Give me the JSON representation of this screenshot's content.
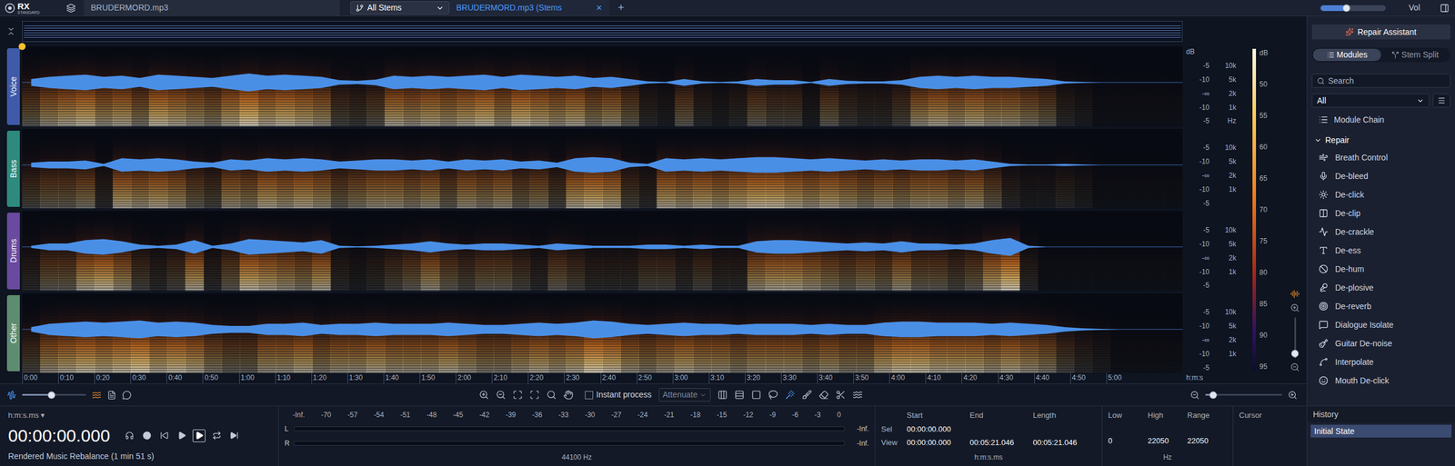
{
  "top_bar": {
    "logo": "RX",
    "edition": "STANDARD",
    "file_tab": "BRUDERMORD.mp3",
    "stem_select": "All Stems",
    "active_tab": "BRUDERMORD.mp3 (Stems",
    "close": "✕",
    "add": "+",
    "volume": {
      "label": "Vol",
      "level": 0.4
    }
  },
  "lanes": [
    {
      "name": "Voice",
      "color": "#3f5aa8",
      "waveform": [
        0.3,
        0.5,
        0.6,
        0.7,
        0.5,
        0.6,
        0.4,
        0.7,
        0.6,
        0.5,
        0.4,
        0.6,
        0.8,
        0.6,
        0.7,
        0.6,
        0.5,
        0.2,
        0.15,
        0.25,
        0.6,
        0.5,
        0.6,
        0.5,
        0.6,
        0.7,
        0.5,
        0.7,
        0.6,
        0.5,
        0.6,
        0.4,
        0.5,
        0.3,
        0.1,
        0.05,
        0.3,
        0.1,
        0.05,
        0.1,
        0.3,
        0.2,
        0.2,
        0.05,
        0.3,
        0.15,
        0.1,
        0.1,
        0.2,
        0.5,
        0.6,
        0.5,
        0.6,
        0.5,
        0.5,
        0.4,
        0.3,
        0.1,
        0.05,
        0,
        0,
        0,
        0,
        0
      ]
    },
    {
      "name": "Bass",
      "color": "#2d8a7c",
      "waveform": [
        0.2,
        0.3,
        0.3,
        0.4,
        0.1,
        0.6,
        0.5,
        0.6,
        0.5,
        0.3,
        0.2,
        0.5,
        0.4,
        0.6,
        0.5,
        0.6,
        0.5,
        0.3,
        0.4,
        0.5,
        0.5,
        0.4,
        0.5,
        0.3,
        0.5,
        0.4,
        0.5,
        0.3,
        0.4,
        0.2,
        0.6,
        0.7,
        0.6,
        0.2,
        0.1,
        0.6,
        0.5,
        0.6,
        0.5,
        0.6,
        0.7,
        0.7,
        0.6,
        0.5,
        0.6,
        0.5,
        0.4,
        0.5,
        0.4,
        0.5,
        0.5,
        0.4,
        0.5,
        0.3,
        0.1,
        0.05,
        0.05,
        0.1,
        0.05,
        0,
        0,
        0,
        0,
        0
      ]
    },
    {
      "name": "Drums",
      "color": "#6a4a9e",
      "waveform": [
        0.1,
        0.3,
        0.3,
        0.6,
        0.7,
        0.5,
        0.2,
        0.1,
        0.2,
        0.6,
        0.1,
        0.3,
        0.7,
        0.6,
        0.5,
        0.4,
        0.6,
        0.1,
        0.05,
        0.1,
        0.2,
        0.3,
        0.5,
        0.3,
        0.2,
        0.3,
        0.3,
        0.2,
        0.1,
        0.3,
        0.2,
        0.1,
        0.1,
        0.1,
        0.2,
        0.2,
        0.1,
        0.2,
        0.1,
        0.1,
        0.5,
        0.6,
        0.6,
        0.5,
        0.4,
        0.3,
        0.4,
        0.3,
        0.5,
        0.3,
        0.3,
        0.2,
        0.3,
        0.6,
        0.8,
        0.1,
        0,
        0,
        0,
        0,
        0,
        0,
        0,
        0
      ]
    },
    {
      "name": "Other",
      "color": "#5e8c70",
      "waveform": [
        0.2,
        0.5,
        0.6,
        0.7,
        0.6,
        0.7,
        0.8,
        0.6,
        0.7,
        0.6,
        0.4,
        0.3,
        0.3,
        0.5,
        0.5,
        0.6,
        0.4,
        0.5,
        0.5,
        0.6,
        0.5,
        0.5,
        0.5,
        0.6,
        0.5,
        0.4,
        0.4,
        0.5,
        0.6,
        0.5,
        0.6,
        0.8,
        0.7,
        0.5,
        0.4,
        0.5,
        0.6,
        0.5,
        0.5,
        0.4,
        0.5,
        0.5,
        0.5,
        0.4,
        0.5,
        0.4,
        0.4,
        0.6,
        0.7,
        0.7,
        0.6,
        0.6,
        0.6,
        0.5,
        0.6,
        0.5,
        0.4,
        0.2,
        0.1,
        0.05,
        0,
        0,
        0,
        0
      ]
    }
  ],
  "scale": {
    "db_label": "dB",
    "hz_label": "Hz",
    "db": [
      "-5",
      "-10",
      "-∞",
      "-10",
      "-5"
    ],
    "hz": [
      "10k",
      "5k",
      "2k",
      "1k"
    ]
  },
  "colorbar": {
    "label": "dB",
    "ticks": [
      "50",
      "55",
      "60",
      "65",
      "70",
      "75",
      "80",
      "85",
      "90",
      "95"
    ]
  },
  "ruler": {
    "ticks": [
      "0:00",
      "0:10",
      "0:20",
      "0:30",
      "0:40",
      "0:50",
      "1:00",
      "1:10",
      "1:20",
      "1:30",
      "1:40",
      "1:50",
      "2:00",
      "2:10",
      "2:20",
      "2:30",
      "2:40",
      "2:50",
      "3:00",
      "3:10",
      "3:20",
      "3:30",
      "3:40",
      "3:50",
      "4:00",
      "4:10",
      "4:20",
      "4:30",
      "4:40",
      "4:50",
      "5:00"
    ],
    "unit": "h:m:s"
  },
  "playhead": {
    "level": 0
  },
  "toolbar": {
    "instant_process": {
      "label": "Instant process",
      "checked": false
    },
    "mode": "Attenuate",
    "waveform_zoom": {
      "level": 0.45
    },
    "time_zoom": {
      "level": 0.1
    }
  },
  "vertical_zoom": {
    "level": 0.1
  },
  "transport": {
    "format": "h:m:s.ms ▾",
    "time": "00:00:00.000",
    "buttons": [
      {
        "kind": "headphones",
        "selected": false
      },
      {
        "kind": "record",
        "selected": false
      },
      {
        "kind": "rewind",
        "selected": false
      },
      {
        "kind": "play",
        "selected": false
      },
      {
        "kind": "play-selection",
        "selected": true
      },
      {
        "kind": "loop",
        "selected": false
      },
      {
        "kind": "play-to-end",
        "selected": false
      }
    ],
    "status": "Rendered Music Rebalance (1 min 51 s)"
  },
  "meter": {
    "scale": [
      "-Inf.",
      "-70",
      "-57",
      "-54",
      "-51",
      "-48",
      "-45",
      "-42",
      "-39",
      "-36",
      "-33",
      "-30",
      "-27",
      "-24",
      "-21",
      "-18",
      "-15",
      "-12",
      "-9",
      "-6",
      "-3",
      "0"
    ],
    "channels": [
      {
        "label": "L",
        "reading": "-Inf.",
        "level": 0
      },
      {
        "label": "R",
        "reading": "-Inf.",
        "level": 0
      }
    ],
    "sample_rate": "44100 Hz"
  },
  "selection": {
    "headers": [
      "Start",
      "End",
      "Length"
    ],
    "rows": [
      {
        "label": "Sel",
        "values": [
          "00:00:00.000",
          "",
          ""
        ]
      },
      {
        "label": "View",
        "values": [
          "00:00:00.000",
          "00:05:21.046",
          "00:05:21.046"
        ]
      }
    ],
    "unit": "h:m:s.ms"
  },
  "frequency": {
    "headers": [
      "Low",
      "High",
      "Range"
    ],
    "rows": [
      {
        "values": [
          "",
          "",
          ""
        ]
      },
      {
        "values": [
          "0",
          "22050",
          "22050"
        ]
      }
    ],
    "unit": "Hz"
  },
  "cursor": {
    "header": "Cursor"
  },
  "panel": {
    "assistant": "Repair Assistant",
    "tabs": [
      {
        "label": "Modules",
        "selected": true
      },
      {
        "label": "Stem Split",
        "selected": false
      }
    ],
    "search": {
      "placeholder": "Search"
    },
    "filter": "All",
    "module_chain": "Module Chain",
    "group": {
      "label": "Repair",
      "expanded": true
    },
    "modules": [
      "Breath Control",
      "De-bleed",
      "De-click",
      "De-clip",
      "De-crackle",
      "De-ess",
      "De-hum",
      "De-plosive",
      "De-reverb",
      "Dialogue Isolate",
      "Guitar De-noise",
      "Interpolate",
      "Mouth De-click"
    ]
  },
  "history": {
    "title": "History",
    "items": [
      {
        "label": "Initial State",
        "selected": true
      }
    ]
  }
}
